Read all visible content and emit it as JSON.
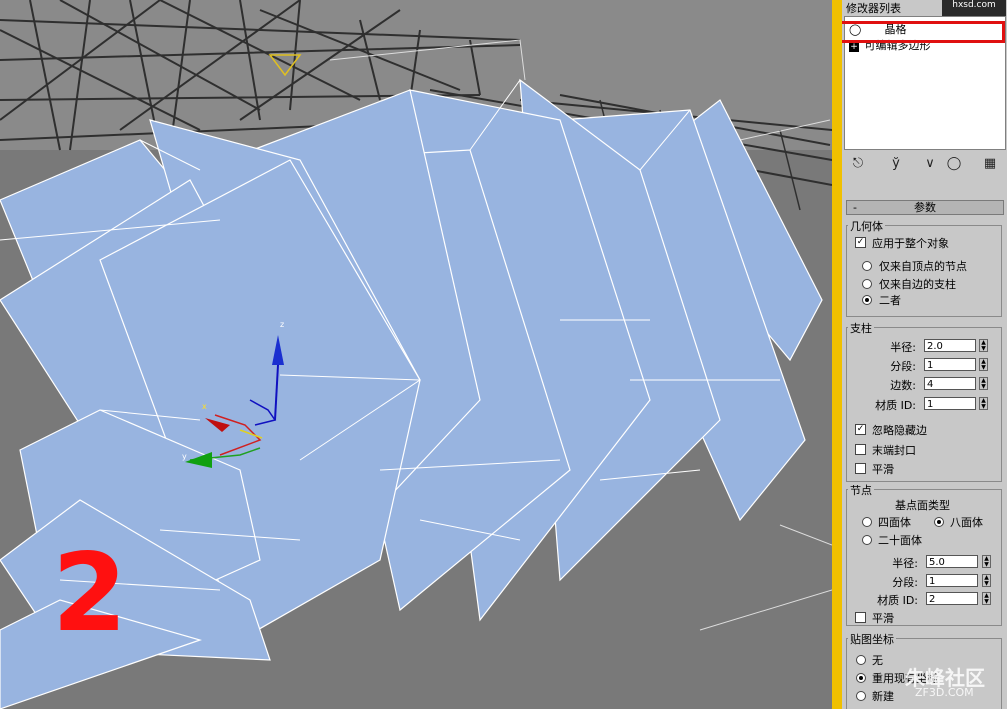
{
  "viewport": {
    "step_number": "2",
    "axis_labels": {
      "z": "z",
      "x": "x",
      "y": "y"
    },
    "colors": {
      "background": "#797979",
      "object_fill": "#98b4e0",
      "edge": "#ffffff",
      "wire": "#3a3a3a",
      "step_number": "#ff1010"
    }
  },
  "panel": {
    "stack_title": "修改器列表",
    "watermark_top": "hxsd.com",
    "stack_items": [
      {
        "label": "晶格",
        "icon": "lightbulb-icon",
        "selected": true
      },
      {
        "label": "可编辑多边形",
        "icon": "plus-icon",
        "selected": false
      }
    ],
    "toolbar_icons": [
      "pin-icon",
      "show-end-result-icon",
      "make-unique-icon",
      "remove-modifier-icon",
      "configure-icon"
    ],
    "rollout": {
      "title": "参数",
      "collapse_symbol": "-",
      "geometry": {
        "label": "几何体",
        "apply_whole": {
          "label": "应用于整个对象",
          "checked": true
        },
        "options": [
          {
            "label": "仅来自顶点的节点",
            "selected": false
          },
          {
            "label": "仅来自边的支柱",
            "selected": false
          },
          {
            "label": "二者",
            "selected": true
          }
        ]
      },
      "struts": {
        "label": "支柱",
        "fields": [
          {
            "label": "半径:",
            "value": "2.0"
          },
          {
            "label": "分段:",
            "value": "1"
          },
          {
            "label": "边数:",
            "value": "4"
          },
          {
            "label": "材质 ID:",
            "value": "1"
          }
        ],
        "checks": [
          {
            "label": "忽略隐藏边",
            "checked": true
          },
          {
            "label": "末端封口",
            "checked": false
          },
          {
            "label": "平滑",
            "checked": false
          }
        ]
      },
      "joints": {
        "label": "节点",
        "type_label": "基点面类型",
        "types": [
          {
            "label": "四面体",
            "selected": false
          },
          {
            "label": "八面体",
            "selected": true
          },
          {
            "label": "二十面体",
            "selected": false
          }
        ],
        "fields": [
          {
            "label": "半径:",
            "value": "5.0"
          },
          {
            "label": "分段:",
            "value": "1"
          },
          {
            "label": "材质 ID:",
            "value": "2"
          }
        ],
        "smooth": {
          "label": "平滑",
          "checked": false
        }
      },
      "mapping": {
        "label": "贴图坐标",
        "options": [
          {
            "label": "无",
            "selected": false
          },
          {
            "label": "重用现有坐标",
            "selected": true
          },
          {
            "label": "新建",
            "selected": false
          }
        ]
      }
    }
  },
  "watermark_bottom": {
    "text": "朱峰社区",
    "sub": "ZF3D.COM"
  }
}
